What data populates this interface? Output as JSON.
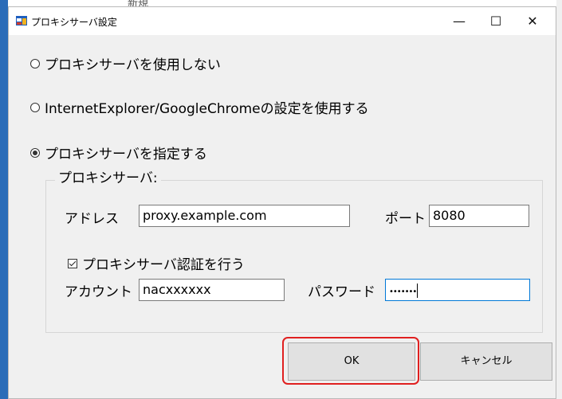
{
  "background": {
    "top_text": "新規"
  },
  "window": {
    "title": "プロキシサーバ設定",
    "controls": {
      "minimize": "—",
      "maximize": "☐",
      "close": "✕"
    }
  },
  "options": {
    "no_proxy": {
      "label": "プロキシサーバを使用しない",
      "checked": false
    },
    "use_browser": {
      "label": "InternetExplorer/GoogleChromeの設定を使用する",
      "checked": false
    },
    "specify": {
      "label": "プロキシサーバを指定する",
      "checked": true
    }
  },
  "proxy_group": {
    "title": "プロキシサーバ:",
    "address_label": "アドレス",
    "address_value": "proxy.example.com",
    "port_label": "ポート",
    "port_value": "8080",
    "auth_checkbox_label": "プロキシサーバ認証を行う",
    "auth_checked": true,
    "account_label": "アカウント",
    "account_value": "nacxxxxxx",
    "password_label": "パスワード",
    "password_masked": "•••••••"
  },
  "buttons": {
    "ok": "OK",
    "cancel": "キャンセル"
  },
  "colors": {
    "highlight": "#e02020",
    "accent": "#0078d7",
    "taskbar": "#2b6cb8"
  }
}
